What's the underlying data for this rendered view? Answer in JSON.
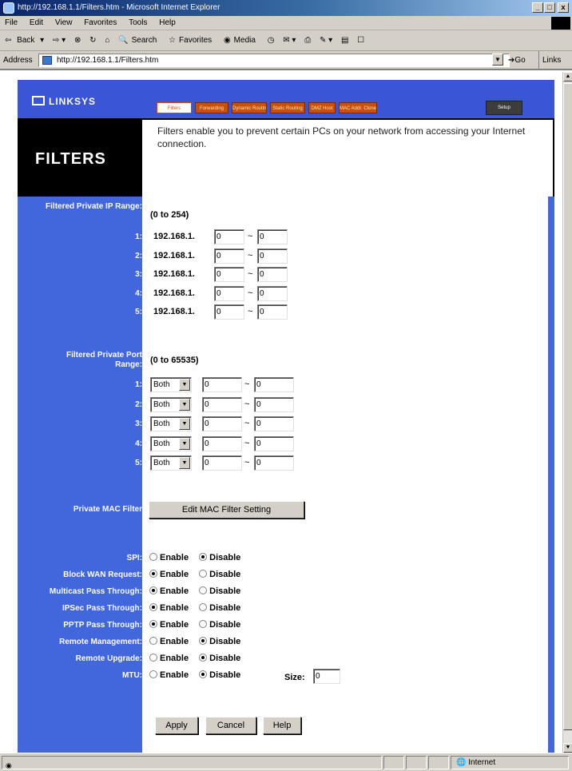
{
  "window": {
    "title": "http://192.168.1.1/Filters.htm - Microsoft Internet Explorer",
    "controls": [
      "_",
      "□",
      "x"
    ]
  },
  "menubar": [
    "File",
    "Edit",
    "View",
    "Favorites",
    "Tools",
    "Help"
  ],
  "toolbar": {
    "back": "Back",
    "search": "Search",
    "favorites": "Favorites",
    "media": "Media"
  },
  "address": {
    "label": "Address",
    "url": "http://192.168.1.1/Filters.htm",
    "go": "Go",
    "links": "Links"
  },
  "brand": {
    "logo": "Linksys"
  },
  "tabs": [
    {
      "label": "Filters",
      "active": true
    },
    {
      "label": "Forwarding"
    },
    {
      "label": "Dynamic Routing"
    },
    {
      "label": "Static Routing"
    },
    {
      "label": "DMZ Host"
    },
    {
      "label": "MAC Addr. Clone"
    },
    {
      "label": "Setup"
    }
  ],
  "page": {
    "title": "FILTERS",
    "description": "Filters enable you to prevent certain PCs on your network from accessing your Internet connection."
  },
  "ip_filter": {
    "label": "Filtered Private IP Range:",
    "range_note": "(0 to 254)",
    "prefix": "192.168.1.",
    "rows": [
      {
        "num": "1:",
        "from": "0",
        "to": "0"
      },
      {
        "num": "2:",
        "from": "0",
        "to": "0"
      },
      {
        "num": "3:",
        "from": "0",
        "to": "0"
      },
      {
        "num": "4:",
        "from": "0",
        "to": "0"
      },
      {
        "num": "5:",
        "from": "0",
        "to": "0"
      }
    ]
  },
  "port_filter": {
    "label": "Filtered Private Port Range:",
    "range_note": "(0 to 65535)",
    "rows": [
      {
        "num": "1:",
        "protocol": "Both",
        "from": "0",
        "to": "0"
      },
      {
        "num": "2:",
        "protocol": "Both",
        "from": "0",
        "to": "0"
      },
      {
        "num": "3:",
        "protocol": "Both",
        "from": "0",
        "to": "0"
      },
      {
        "num": "4:",
        "protocol": "Both",
        "from": "0",
        "to": "0"
      },
      {
        "num": "5:",
        "protocol": "Both",
        "from": "0",
        "to": "0"
      }
    ]
  },
  "mac_filter": {
    "label": "Private MAC Filter",
    "button": "Edit MAC Filter Setting"
  },
  "options": [
    {
      "label": "SPI:",
      "enable": "Enable",
      "disable": "Disable",
      "selected": "disable"
    },
    {
      "label": "Block WAN Request:",
      "enable": "Enable",
      "disable": "Disable",
      "selected": "enable"
    },
    {
      "label": "Multicast Pass Through:",
      "enable": "Enable",
      "disable": "Disable",
      "selected": "enable"
    },
    {
      "label": "IPSec Pass Through:",
      "enable": "Enable",
      "disable": "Disable",
      "selected": "enable"
    },
    {
      "label": "PPTP Pass Through:",
      "enable": "Enable",
      "disable": "Disable",
      "selected": "enable"
    },
    {
      "label": "Remote Management:",
      "enable": "Enable",
      "disable": "Disable",
      "selected": "disable"
    },
    {
      "label": "Remote Upgrade:",
      "enable": "Enable",
      "disable": "Disable",
      "selected": "disable"
    },
    {
      "label": "MTU:",
      "enable": "Enable",
      "disable": "Disable",
      "selected": "disable"
    }
  ],
  "mtu": {
    "size_label": "Size:",
    "size": "0"
  },
  "actions": {
    "apply": "Apply",
    "cancel": "Cancel",
    "help": "Help"
  },
  "statusbar": {
    "zone": "Internet"
  },
  "colors": {
    "sidebar_blue": "#4266dc",
    "tab_orange": "#c8500a",
    "header_black": "#000000"
  }
}
